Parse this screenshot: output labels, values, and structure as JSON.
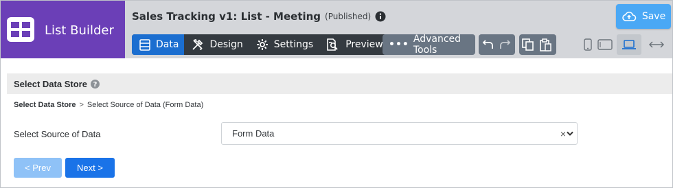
{
  "brand": {
    "title": "List Builder",
    "icon": "grid-icon",
    "color": "#6b3fb7"
  },
  "header": {
    "app_title": "Sales Tracking v1: List - Meeting",
    "status": "(Published)",
    "save_label": "Save"
  },
  "tabs": [
    {
      "label": "Data",
      "icon": "data-icon",
      "active": true
    },
    {
      "label": "Design",
      "icon": "design-icon",
      "active": false
    },
    {
      "label": "Settings",
      "icon": "gear-icon",
      "active": false
    },
    {
      "label": "Preview",
      "icon": "preview-icon",
      "active": false
    }
  ],
  "toolbar": {
    "advanced_label": "Advanced Tools",
    "undo": "undo-icon",
    "redo": "redo-icon",
    "copy": "copy-icon",
    "paste": "paste-icon"
  },
  "devices": [
    "phone-icon",
    "tablet-icon",
    "laptop-icon",
    "expand-icon"
  ],
  "section": {
    "title": "Select Data Store"
  },
  "breadcrumb": {
    "current": "Select Data Store",
    "separator": ">",
    "next": "Select Source of Data (Form Data)"
  },
  "form": {
    "label": "Select Source of Data",
    "selected": "Form Data",
    "clear": "×"
  },
  "nav": {
    "prev": "< Prev",
    "next": "Next >"
  },
  "colors": {
    "accent": "#1a73e8",
    "save": "#4aa8f5",
    "tabs_dark": "#343a40",
    "tools": "#697583"
  }
}
